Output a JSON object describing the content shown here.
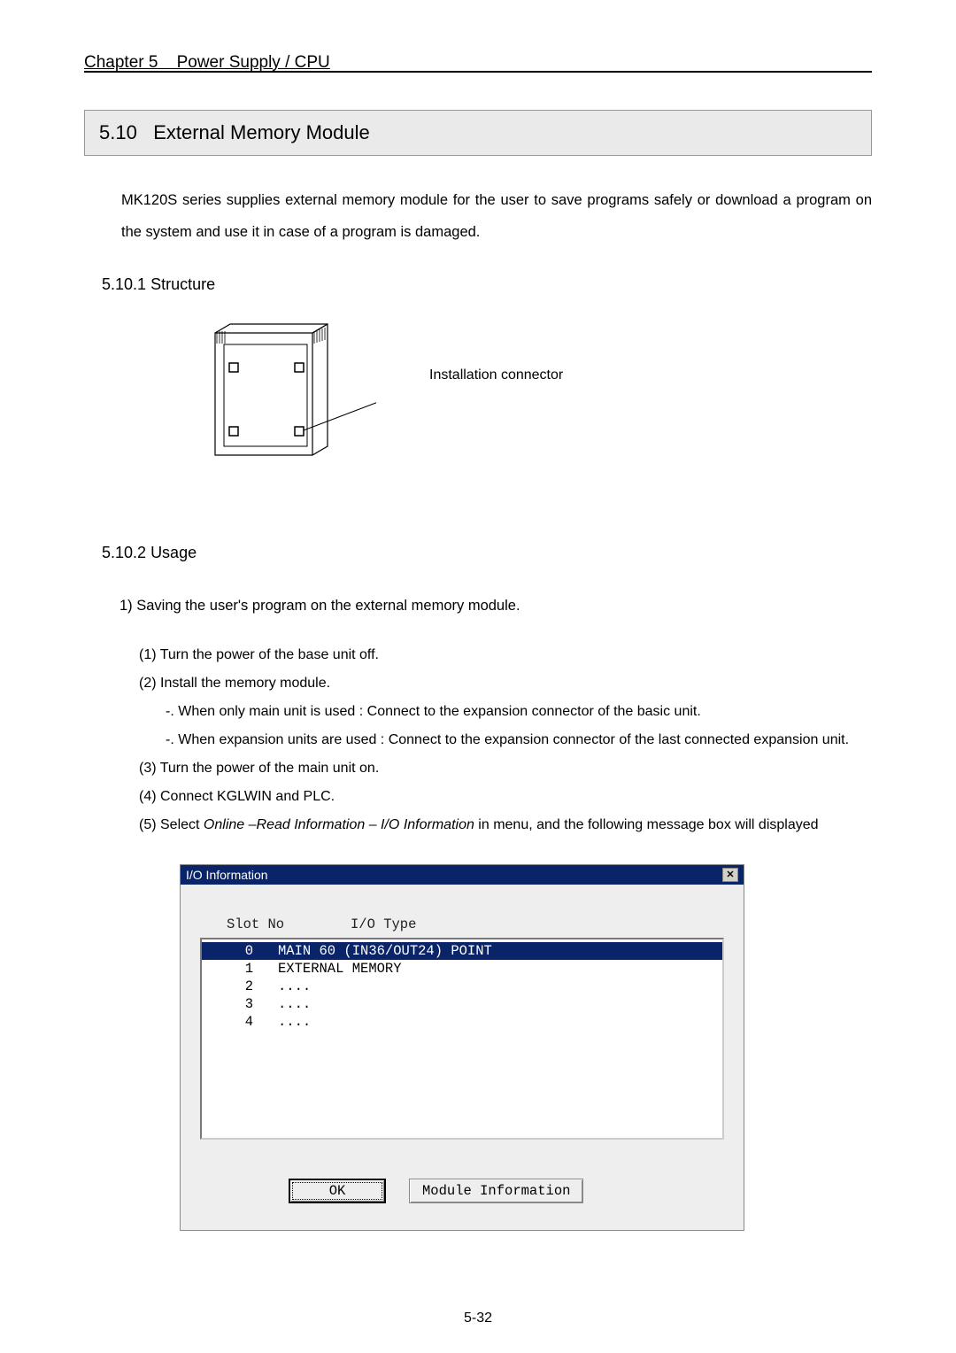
{
  "header": {
    "chapter_label": "Chapter 5",
    "chapter_title": "Power Supply / CPU"
  },
  "section": {
    "number": "5.10",
    "title": "External Memory Module",
    "intro": "MK120S series supplies external memory module for the user to save programs safely or download a program on the system and use it in case of a program is damaged."
  },
  "sub1": {
    "number": "5.10.1",
    "title": "Structure",
    "connector_label": "Installation connector"
  },
  "sub2": {
    "number": "5.10.2",
    "title": "Usage",
    "step_head": "1) Saving the user's program on the external memory module.",
    "steps": [
      "(1) Turn the power of the base unit off.",
      "(2) Install the memory module.",
      "(3) Turn the power of the main unit on.",
      "(4) Connect KGLWIN and PLC.",
      "(5) Select"
    ],
    "sub_bullets": [
      "-. When only main unit is used : Connect to the expansion connector of the basic unit.",
      "-. When expansion units are used : Connect to the expansion connector of the last connected expansion unit."
    ],
    "step5_italic": "Online –Read Information – I/O Information",
    "step5_tail": " in menu, and the following message box will displayed"
  },
  "dialog": {
    "title": "I/O Information",
    "close": "✕",
    "col_slot": "Slot No",
    "col_type": "I/O Type",
    "rows": [
      {
        "slot": "0",
        "type": "MAIN 60 (IN36/OUT24) POINT",
        "selected": true
      },
      {
        "slot": "1",
        "type": "EXTERNAL MEMORY",
        "selected": false
      },
      {
        "slot": "2",
        "type": "....",
        "selected": false
      },
      {
        "slot": "3",
        "type": "....",
        "selected": false
      },
      {
        "slot": "4",
        "type": "....",
        "selected": false
      }
    ],
    "ok_label": "OK",
    "module_info_label": "Module Information"
  },
  "page_number": "5-32"
}
